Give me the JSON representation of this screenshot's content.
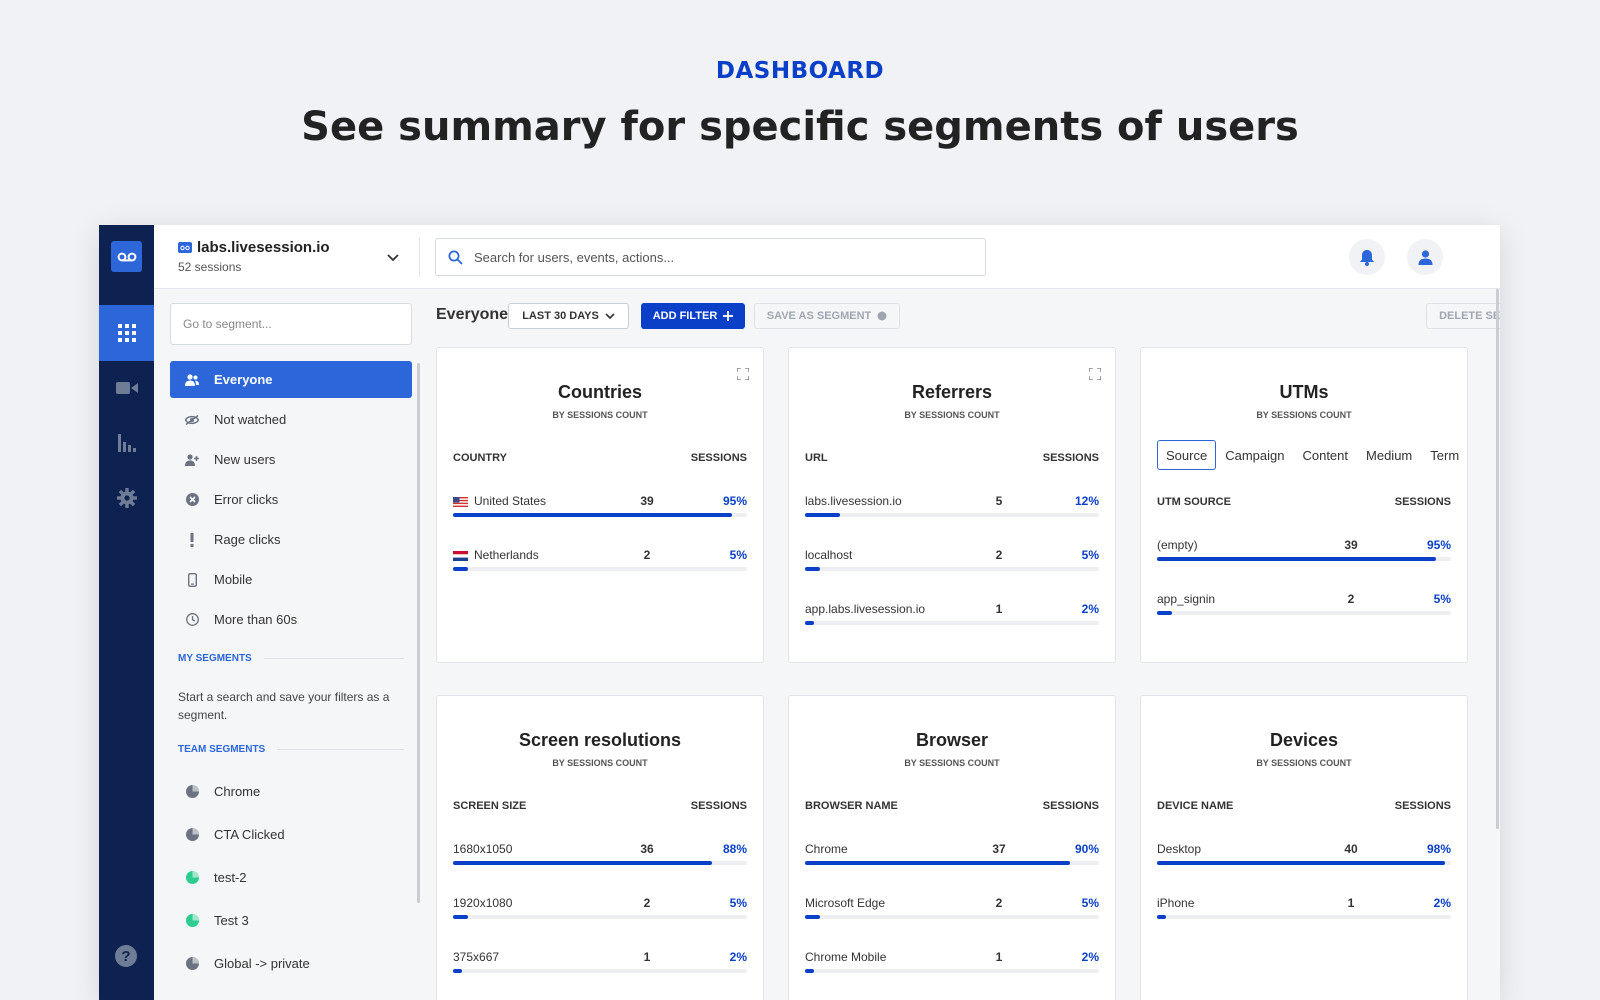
{
  "hero": {
    "eyebrow": "DASHBOARD",
    "title": "See summary for specific segments of users"
  },
  "colors": {
    "accent": "#0a3fc8",
    "rail": "#0d2250",
    "active": "#2c66d8"
  },
  "topbar": {
    "site_name": "labs.livesession.io",
    "site_sessions": "52 sessions",
    "search_placeholder": "Search for users, events, actions..."
  },
  "segments": {
    "search_placeholder": "Go to segment...",
    "items": [
      {
        "label": "Everyone",
        "icon": "users-icon",
        "active": true
      },
      {
        "label": "Not watched",
        "icon": "eye-off-icon"
      },
      {
        "label": "New users",
        "icon": "user-plus-icon"
      },
      {
        "label": "Error clicks",
        "icon": "x-circle-icon"
      },
      {
        "label": "Rage clicks",
        "icon": "exclamation-icon"
      },
      {
        "label": "Mobile",
        "icon": "mobile-icon"
      },
      {
        "label": "More than 60s",
        "icon": "clock-icon"
      }
    ],
    "my_segments_heading": "MY SEGMENTS",
    "my_segments_note": "Start a search and save your filters as a segment.",
    "team_segments_heading": "TEAM SEGMENTS",
    "team_items": [
      {
        "label": "Chrome",
        "color": "#6b7383"
      },
      {
        "label": "CTA Clicked",
        "color": "#6b7383"
      },
      {
        "label": "test-2",
        "color": "#2ecc8f"
      },
      {
        "label": "Test 3",
        "color": "#2ecc8f"
      },
      {
        "label": "Global -> private",
        "color": "#6b7383"
      }
    ]
  },
  "filterbar": {
    "segment_name": "Everyone",
    "range_label": "LAST 30 DAYS",
    "add_filter_label": "ADD FILTER",
    "save_segment_label": "SAVE AS SEGMENT",
    "delete_segment_label": "DELETE SEGMENT"
  },
  "cards": [
    {
      "title": "Countries",
      "subtitle": "BY SESSIONS COUNT",
      "col_left": "COUNTRY",
      "col_right": "SESSIONS",
      "expandable": true,
      "rows": [
        {
          "label": "United States",
          "flag": "us",
          "count": "39",
          "pct": "95%",
          "fraction": 0.95
        },
        {
          "label": "Netherlands",
          "flag": "nl",
          "count": "2",
          "pct": "5%",
          "fraction": 0.05
        }
      ]
    },
    {
      "title": "Referrers",
      "subtitle": "BY SESSIONS COUNT",
      "col_left": "URL",
      "col_right": "SESSIONS",
      "expandable": true,
      "rows": [
        {
          "label": "labs.livesession.io",
          "count": "5",
          "pct": "12%",
          "fraction": 0.12
        },
        {
          "label": "localhost",
          "count": "2",
          "pct": "5%",
          "fraction": 0.05
        },
        {
          "label": "app.labs.livesession.io",
          "count": "1",
          "pct": "2%",
          "fraction": 0.02
        }
      ]
    },
    {
      "title": "UTMs",
      "subtitle": "BY SESSIONS COUNT",
      "col_left": "UTM SOURCE",
      "col_right": "SESSIONS",
      "tabs": [
        "Source",
        "Campaign",
        "Content",
        "Medium",
        "Term"
      ],
      "rows": [
        {
          "label": "(empty)",
          "count": "39",
          "pct": "95%",
          "fraction": 0.95
        },
        {
          "label": "app_signin",
          "count": "2",
          "pct": "5%",
          "fraction": 0.05
        }
      ]
    },
    {
      "title": "Screen resolutions",
      "subtitle": "BY SESSIONS COUNT",
      "col_left": "SCREEN SIZE",
      "col_right": "SESSIONS",
      "rows": [
        {
          "label": "1680x1050",
          "count": "36",
          "pct": "88%",
          "fraction": 0.88
        },
        {
          "label": "1920x1080",
          "count": "2",
          "pct": "5%",
          "fraction": 0.05
        },
        {
          "label": "375x667",
          "count": "1",
          "pct": "2%",
          "fraction": 0.02
        }
      ]
    },
    {
      "title": "Browser",
      "subtitle": "BY SESSIONS COUNT",
      "col_left": "BROWSER NAME",
      "col_right": "SESSIONS",
      "rows": [
        {
          "label": "Chrome",
          "count": "37",
          "pct": "90%",
          "fraction": 0.9
        },
        {
          "label": "Microsoft Edge",
          "count": "2",
          "pct": "5%",
          "fraction": 0.05
        },
        {
          "label": "Chrome Mobile",
          "count": "1",
          "pct": "2%",
          "fraction": 0.02
        }
      ]
    },
    {
      "title": "Devices",
      "subtitle": "BY SESSIONS COUNT",
      "col_left": "DEVICE NAME",
      "col_right": "SESSIONS",
      "rows": [
        {
          "label": "Desktop",
          "count": "40",
          "pct": "98%",
          "fraction": 0.98
        },
        {
          "label": "iPhone",
          "count": "1",
          "pct": "2%",
          "fraction": 0.02
        }
      ]
    }
  ],
  "help_label": "?"
}
